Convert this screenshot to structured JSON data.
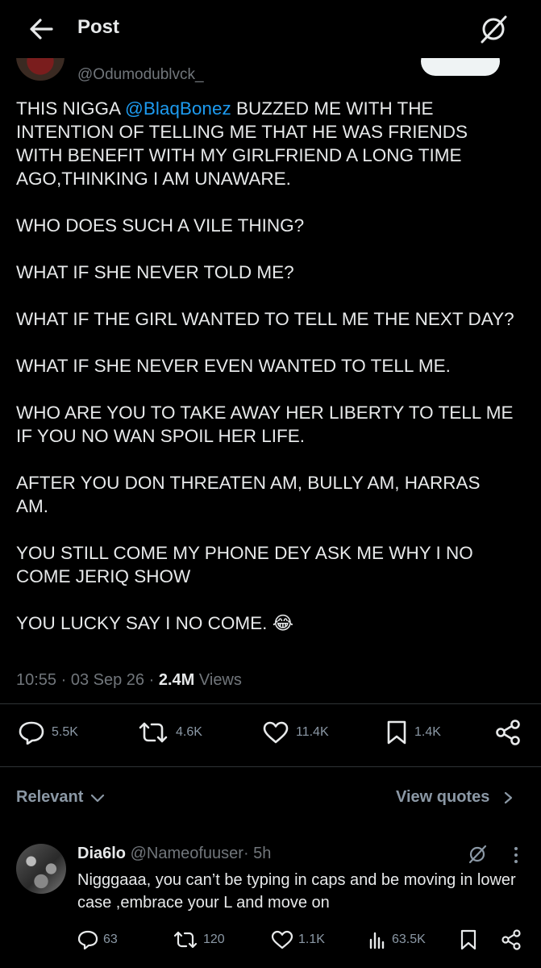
{
  "header": {
    "title": "Post",
    "back_icon": "arrow-left-icon",
    "grok_icon": "grok-slash-icon"
  },
  "author": {
    "handle": "@Odumodublvck_"
  },
  "tweet": {
    "paragraphs": [
      {
        "before": "THIS NIGGA ",
        "mention": "@BlaqBonez",
        "after": " BUZZED ME WITH THE INTENTION OF TELLING ME THAT HE WAS FRIENDS WITH BENEFIT WITH MY GIRLFRIEND A LONG TIME AGO,THINKING I AM UNAWARE."
      },
      {
        "text": "WHO DOES SUCH A VILE THING?"
      },
      {
        "text": "WHAT IF SHE NEVER TOLD ME?"
      },
      {
        "text": "WHAT IF THE GIRL WANTED TO TELL ME THE NEXT DAY?"
      },
      {
        "text": "WHAT IF SHE NEVER EVEN WANTED TO TELL ME."
      },
      {
        "text": "WHO ARE YOU TO TAKE AWAY HER LIBERTY TO TELL ME IF YOU NO WAN SPOIL HER LIFE."
      },
      {
        "text": "AFTER YOU DON THREATEN AM, BULLY AM, HARRAS AM."
      },
      {
        "text": "YOU STILL COME MY PHONE DEY ASK ME WHY I NO COME JERIQ SHOW"
      },
      {
        "text": "YOU LUCKY SAY I NO COME. 😂"
      }
    ],
    "time": "10:55",
    "date": "03 Sep 26",
    "views_count": "2.4M",
    "views_label": "Views",
    "separator": "·"
  },
  "actions": {
    "replies": "5.5K",
    "reposts": "4.6K",
    "likes": "11.4K",
    "bookmarks": "1.4K"
  },
  "sort": {
    "label": "Relevant",
    "quotes_label": "View quotes"
  },
  "reply": {
    "name": "Dia6lo",
    "handle": "@Nameofuuser",
    "time": "· 5h",
    "text": "Nigggaaa, you can’t be typing in caps and be moving in lower case ,embrace your L and move on",
    "replies": "63",
    "reposts": "120",
    "likes": "1.1K",
    "views": "63.5K"
  },
  "colors": {
    "background": "#000000",
    "text": "#e7e9ea",
    "muted": "#71767b",
    "accent": "#1d9bf0",
    "divider": "#2f3336"
  }
}
